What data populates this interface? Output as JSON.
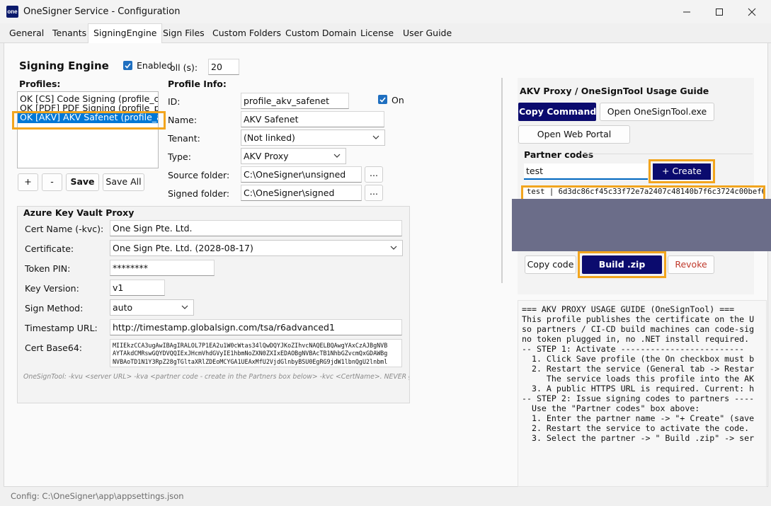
{
  "window": {
    "app_icon_text": "one",
    "title": "OneSigner Service - Configuration"
  },
  "tabs": [
    {
      "label": "General"
    },
    {
      "label": "Tenants"
    },
    {
      "label": "SigningEngine"
    },
    {
      "label": "Sign Files"
    },
    {
      "label": "Custom Folders"
    },
    {
      "label": "Custom Domain"
    },
    {
      "label": "License"
    },
    {
      "label": "User Guide"
    }
  ],
  "engine": {
    "title": "Signing Engine",
    "enabled_label": "Enabled",
    "enabled_checked": true,
    "poll_label": "oll (s):",
    "poll_value": "20"
  },
  "profiles": {
    "label": "Profiles:",
    "items": [
      "OK [CS] Code Signing (profile_codesi",
      "OK [PDF] PDF Signing (profile_pdf)",
      "OK [AKV] AKV Safenet (profile_akv_sa"
    ],
    "add_label": "+",
    "remove_label": "-",
    "save_label": "Save",
    "save_all_label": "Save All"
  },
  "profile_info": {
    "label": "Profile Info:",
    "id_label": "ID:",
    "id_value": "profile_akv_safenet",
    "on_label": "On",
    "name_label": "Name:",
    "name_value": "AKV Safenet",
    "tenant_label": "Tenant:",
    "tenant_value": "(Not linked)",
    "type_label": "Type:",
    "type_value": "AKV Proxy",
    "source_label": "Source folder:",
    "source_value": "C:\\OneSigner\\unsigned",
    "signed_label": "Signed folder:",
    "signed_value": "C:\\OneSigner\\signed",
    "browse_label": "..."
  },
  "akv": {
    "title": "Azure Key Vault Proxy",
    "cert_name_label": "Cert Name (-kvc):",
    "cert_name_value": "One Sign Pte. Ltd.",
    "certificate_label": "Certificate:",
    "certificate_value": "One Sign Pte. Ltd. (2028-08-17)",
    "token_pin_label": "Token PIN:",
    "token_pin_value": "********",
    "key_version_label": "Key Version:",
    "key_version_value": "v1",
    "sign_method_label": "Sign Method:",
    "sign_method_value": "auto",
    "timestamp_label": "Timestamp URL:",
    "timestamp_value": "http://timestamp.globalsign.com/tsa/r6advanced1",
    "cert_b64_label": "Cert Base64:",
    "cert_b64_lines": [
      "MIIEkzCCA3ugAwIBAgIRALOL7P1EA2u1W0cWtas34lQwDQYJKoZIhvcNAQELBQAwgYAxCzAJBgNVB",
      "AYTAkdCMRswGQYDVQQIExJHcmVhdGVyIE1hbmNoZXN0ZXIxEDAOBgNVBAcTB1NhbGZvcmQxGDAWBg",
      "NVBAoTD1N1Y3RpZ28gTGltaXRlZDEoMCYGA1UEAxMfU2VjdGlnbyBSU0EgRG9jdW1lbnQgU2lnbml"
    ],
    "hint": "OneSignTool: -kvu <server URL> -kva <partner code - create in the Partners box below> -kvc <CertName>. NEVER give the"
  },
  "guide_panel": {
    "title": "AKV Proxy / OneSignTool Usage Guide",
    "copy_command_label": "Copy Command",
    "open_tool_label": "Open OneSignTool.exe",
    "open_portal_label": "Open Web Portal",
    "partner_codes_label": "Partner codes",
    "partner_input_value": "test",
    "create_label": "+ Create",
    "partner_code_entry": "test | 6d3dc86cf45c33f72e7a2407c48140b7f6c3724c00bef6",
    "copy_code_label": "Copy code",
    "build_zip_label": "Build .zip",
    "revoke_label": "Revoke",
    "guide_lines": [
      "=== AKV PROXY USAGE GUIDE (OneSignTool) ===",
      "",
      "This profile publishes the certificate on the U",
      "so partners / CI-CD build machines can code-sig",
      "no token plugged in, no .NET install required.",
      "",
      "-- STEP 1: Activate -------------------------",
      "  1. Click Save profile (the On checkbox must b",
      "  2. Restart the service (General tab -> Restar",
      "     The service loads this profile into the AK",
      "  3. A public HTTPS URL is required. Current: h",
      "",
      "-- STEP 2: Issue signing codes to partners ----",
      "  Use the \"Partner codes\" box above:",
      "  1. Enter the partner name -> \"+ Create\" (save",
      "  2. Restart the service to activate the code.",
      "  3. Select the partner -> \" Build .zip\" -> ser"
    ]
  },
  "status": {
    "config_path": "Config: C:\\OneSigner\\app\\appsettings.json"
  },
  "colors": {
    "accent_dark": "#0b0b6e",
    "highlight": "#f2a51e",
    "selection": "#0078d7",
    "revoke_text": "#c0392b"
  }
}
